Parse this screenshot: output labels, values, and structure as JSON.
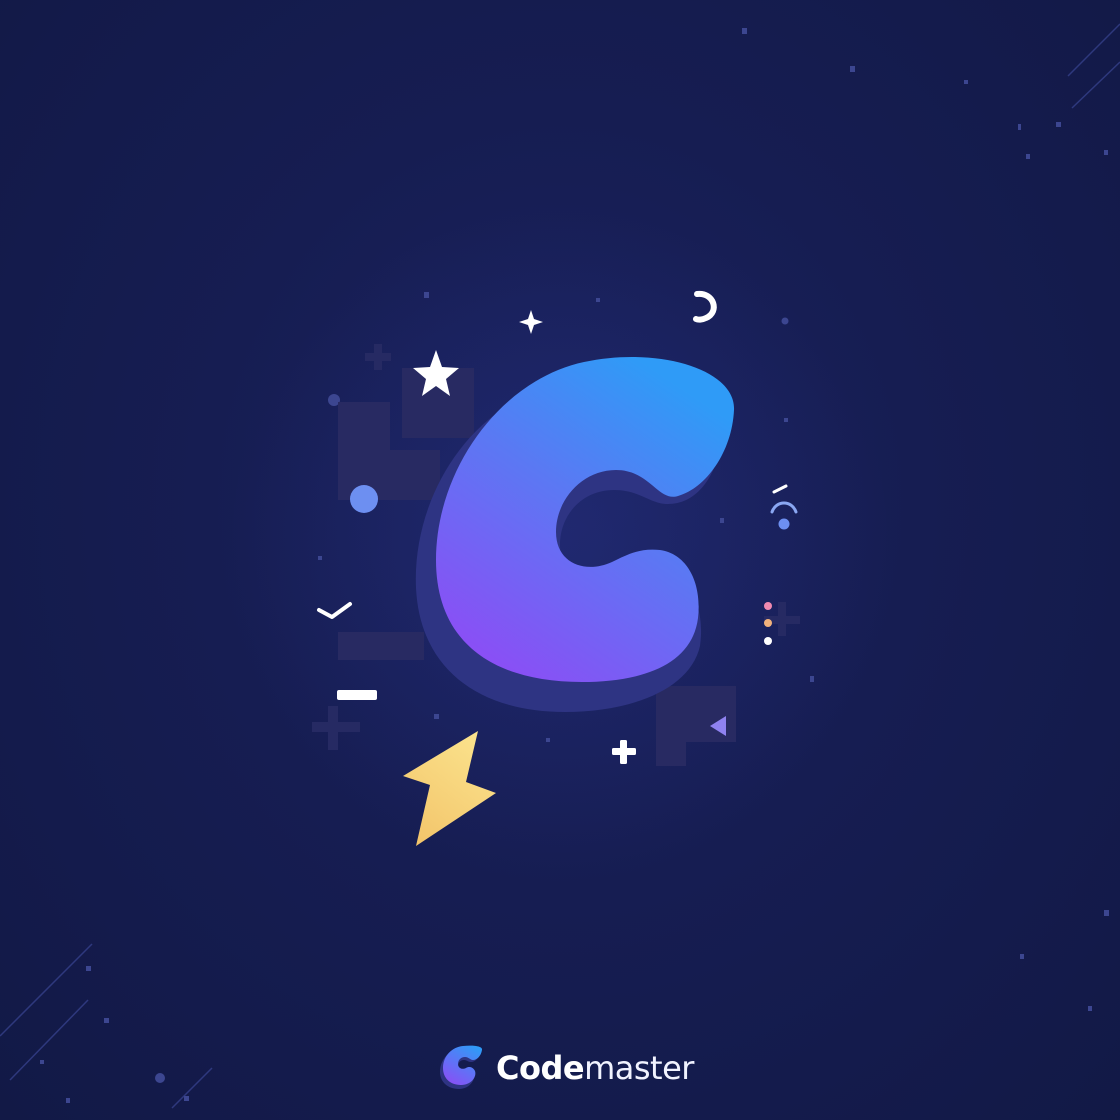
{
  "brand": {
    "name_bold": "Code",
    "name_light": "master"
  },
  "icons": {
    "main_logo": "letter-c-logo-icon",
    "mini_logo": "codemaster-logo-icon",
    "star": "star-icon",
    "sparkle": "sparkle-icon",
    "lightning": "lightning-bolt-icon",
    "plus": "plus-icon",
    "minus": "minus-icon",
    "moon": "crescent-icon",
    "wifi": "signal-arc-icon",
    "check": "checkmark-icon",
    "triangle": "play-triangle-icon",
    "dots": "dots-icon"
  },
  "colors": {
    "background": "#141c4d",
    "logo_gradient_top": "#2f9bf7",
    "logo_gradient_mid": "#5b78f3",
    "logo_gradient_bottom": "#8a4ff5",
    "logo_shadow": "#2e3483",
    "accent_yellow": "#f6d77a",
    "accent_blue_dot": "#6d8ff1",
    "accent_pink": "#f08ab0",
    "block_shape": "#282a62"
  }
}
